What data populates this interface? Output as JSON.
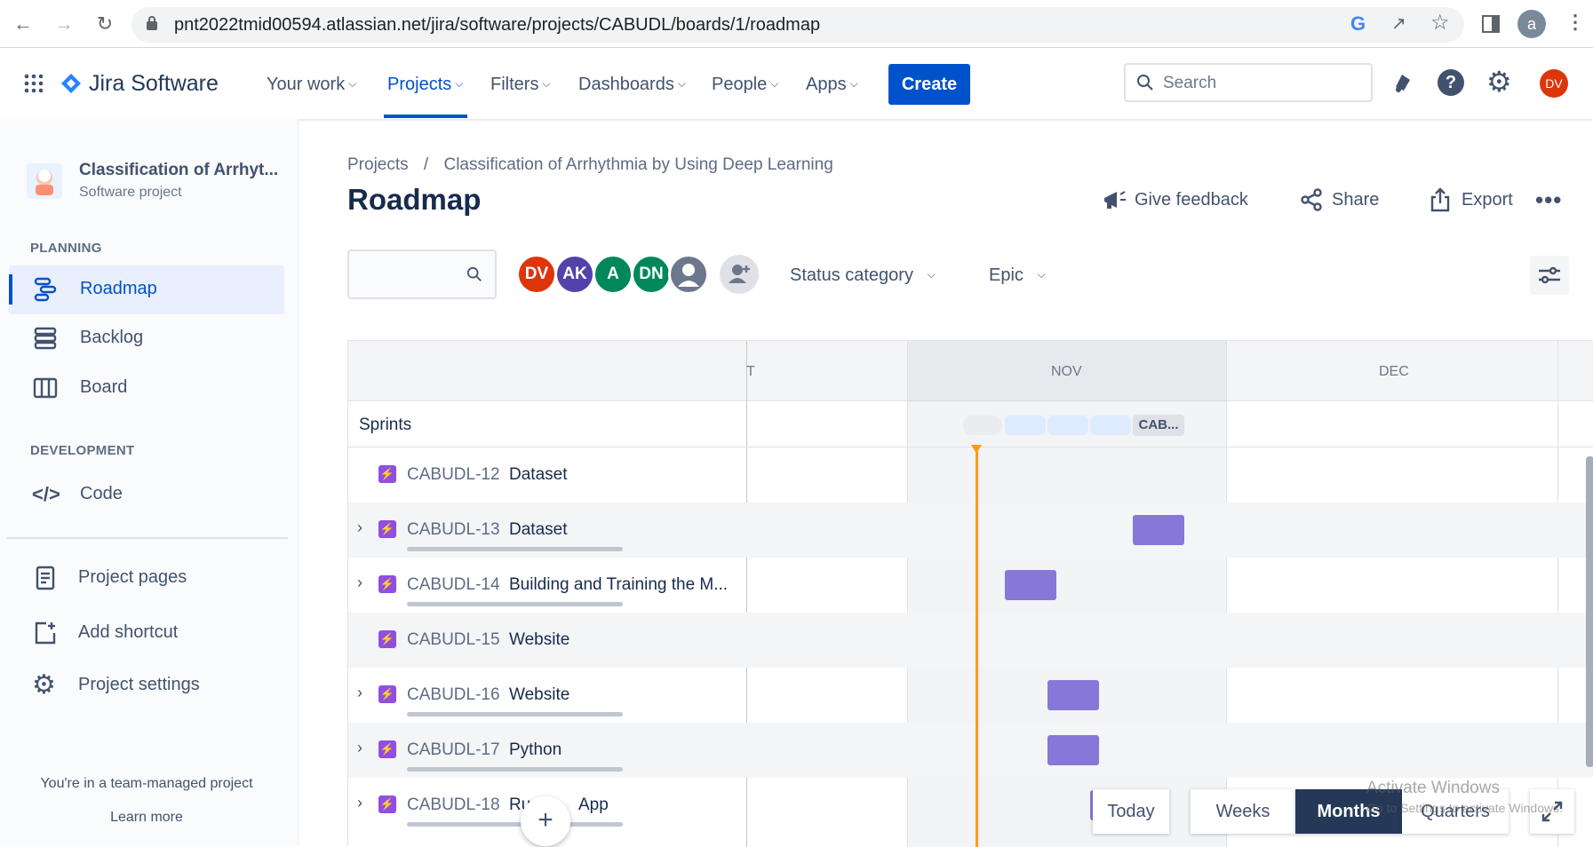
{
  "browser": {
    "url": "pnt2022tmid00594.atlassian.net/jira/software/projects/CABUDL/boards/1/roadmap",
    "profile_letter": "a"
  },
  "nav": {
    "product": "Jira Software",
    "items": [
      {
        "label": "Your work"
      },
      {
        "label": "Projects"
      },
      {
        "label": "Filters"
      },
      {
        "label": "Dashboards"
      },
      {
        "label": "People"
      },
      {
        "label": "Apps"
      }
    ],
    "create_label": "Create",
    "search_placeholder": "Search",
    "user_initials": "DV",
    "accent": "#0052cc"
  },
  "sidebar": {
    "project_name": "Classification of Arrhyt...",
    "project_type": "Software project",
    "planning_header": "PLANNING",
    "planning_items": [
      {
        "label": "Roadmap",
        "icon": "roadmap-icon",
        "selected": true
      },
      {
        "label": "Backlog",
        "icon": "backlog-icon"
      },
      {
        "label": "Board",
        "icon": "board-icon"
      }
    ],
    "development_header": "DEVELOPMENT",
    "development_items": [
      {
        "label": "Code",
        "icon": "code-icon"
      }
    ],
    "other_items": [
      {
        "label": "Project pages",
        "icon": "page-icon"
      },
      {
        "label": "Add shortcut",
        "icon": "add-shortcut-icon"
      },
      {
        "label": "Project settings",
        "icon": "gear-icon"
      }
    ],
    "footer_text": "You're in a team-managed project",
    "learn_more": "Learn more"
  },
  "main": {
    "breadcrumb": {
      "root": "Projects",
      "separator": "/",
      "project": "Classification of Arrhythmia by Using Deep Learning"
    },
    "title": "Roadmap",
    "actions": {
      "feedback": "Give feedback",
      "share": "Share",
      "export": "Export"
    },
    "avatars": [
      {
        "initials": "DV",
        "color": "#de350b"
      },
      {
        "initials": "AK",
        "color": "#5243aa"
      },
      {
        "initials": "A",
        "color": "#00875a"
      },
      {
        "initials": "DN",
        "color": "#00875a"
      }
    ],
    "filters": {
      "status": "Status category",
      "epic": "Epic"
    }
  },
  "timeline": {
    "months": [
      "T",
      "NOV",
      "DEC"
    ],
    "sprints_label": "Sprints",
    "sprint_chip": "CAB...",
    "rows": [
      {
        "key": "CABUDL-12",
        "title": "Dataset",
        "expandable": false
      },
      {
        "key": "CABUDL-13",
        "title": "Dataset",
        "expandable": true
      },
      {
        "key": "CABUDL-14",
        "title": "Building and Training the M...",
        "expandable": true
      },
      {
        "key": "CABUDL-15",
        "title": "Website",
        "expandable": false
      },
      {
        "key": "CABUDL-16",
        "title": "Website",
        "expandable": true
      },
      {
        "key": "CABUDL-17",
        "title": "Python",
        "expandable": true
      },
      {
        "key": "CABUDL-18",
        "title_left": "Ru",
        "title_right": "App",
        "expandable": true
      }
    ],
    "controls": {
      "today": "Today",
      "weeks": "Weeks",
      "months": "Months",
      "quarters": "Quarters",
      "selected": "Months"
    }
  },
  "watermark": {
    "line1": "Activate Windows",
    "line2": "Go to Settings to activate Windows."
  }
}
